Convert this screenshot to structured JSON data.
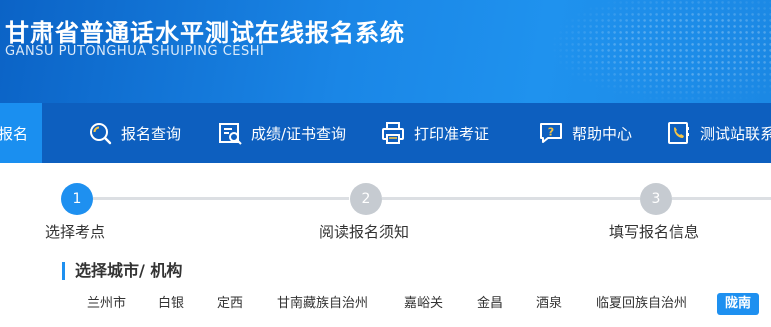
{
  "header": {
    "title": "甘肃省普通话水平测试在线报名系统",
    "subtitle": "GANSU PUTONGHUA SHUIPING CESHI"
  },
  "nav": {
    "items": [
      {
        "label": "报名",
        "icon": "register-icon",
        "active": true
      },
      {
        "label": "报名查询",
        "icon": "search-icon"
      },
      {
        "label": "成绩/证书查询",
        "icon": "certificate-search-icon"
      },
      {
        "label": "打印准考证",
        "icon": "printer-icon"
      },
      {
        "label": "帮助中心",
        "icon": "help-chat-icon"
      },
      {
        "label": "测试站联系",
        "icon": "phone-contact-icon"
      }
    ]
  },
  "steps": [
    {
      "number": "1",
      "label": "选择考点",
      "active": true
    },
    {
      "number": "2",
      "label": "阅读报名须知"
    },
    {
      "number": "3",
      "label": "填写报名信息"
    }
  ],
  "section": {
    "title": "选择城市/ 机构"
  },
  "cities": {
    "row1": [
      "兰州市",
      "白银",
      "定西",
      "甘南藏族自治州",
      "嘉峪关",
      "金昌",
      "酒泉",
      "临夏回族自治州",
      "陇南"
    ],
    "selected": "陇南"
  },
  "colors": {
    "header_blue": "#1a86e6",
    "nav_blue": "#0d5fbf",
    "accent": "#1e90f0",
    "step_inactive": "#c6cbd1"
  }
}
